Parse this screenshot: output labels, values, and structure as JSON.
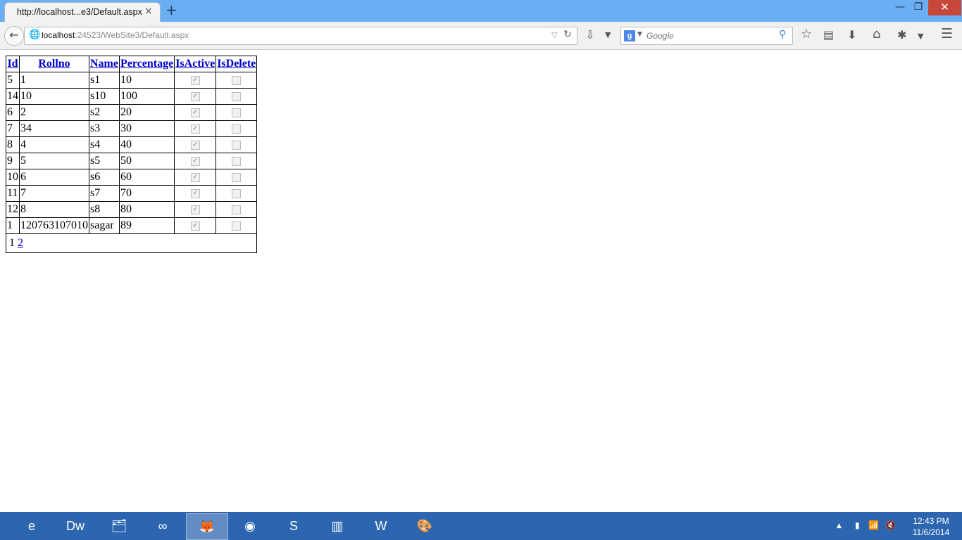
{
  "browser": {
    "tab_title": "http://localhost...e3/Default.aspx",
    "close_tab": "×",
    "new_tab": "+",
    "url_host": "localhost",
    "url_rest": ":24523/WebSite3/Default.aspx",
    "search_placeholder": "Google",
    "window_controls": {
      "minimize": "—",
      "maximize": "❐",
      "close": "✕"
    }
  },
  "grid": {
    "headers": [
      "Id",
      "Rollno",
      "Name",
      "Percentage",
      "IsActive",
      "IsDelete"
    ],
    "rows": [
      {
        "id": "5",
        "rollno": "1",
        "name": "s1",
        "percentage": "10",
        "isactive": true,
        "isdelete": false
      },
      {
        "id": "14",
        "rollno": "10",
        "name": "s10",
        "percentage": "100",
        "isactive": true,
        "isdelete": false
      },
      {
        "id": "6",
        "rollno": "2",
        "name": "s2",
        "percentage": "20",
        "isactive": true,
        "isdelete": false
      },
      {
        "id": "7",
        "rollno": "34",
        "name": "s3",
        "percentage": "30",
        "isactive": true,
        "isdelete": false
      },
      {
        "id": "8",
        "rollno": "4",
        "name": "s4",
        "percentage": "40",
        "isactive": true,
        "isdelete": false
      },
      {
        "id": "9",
        "rollno": "5",
        "name": "s5",
        "percentage": "50",
        "isactive": true,
        "isdelete": false
      },
      {
        "id": "10",
        "rollno": "6",
        "name": "s6",
        "percentage": "60",
        "isactive": true,
        "isdelete": false
      },
      {
        "id": "11",
        "rollno": "7",
        "name": "s7",
        "percentage": "70",
        "isactive": true,
        "isdelete": false
      },
      {
        "id": "12",
        "rollno": "8",
        "name": "s8",
        "percentage": "80",
        "isactive": true,
        "isdelete": false
      },
      {
        "id": "1",
        "rollno": "120763107010",
        "name": "sagar",
        "percentage": "89",
        "isactive": true,
        "isdelete": false
      }
    ],
    "pager": {
      "current": "1",
      "next": "2"
    }
  },
  "taskbar": {
    "apps": [
      {
        "icon": "internet-explorer-icon",
        "label": "e"
      },
      {
        "icon": "dreamweaver-icon",
        "label": "Dw"
      },
      {
        "icon": "file-explorer-icon",
        "label": "🗂"
      },
      {
        "icon": "visual-studio-icon",
        "label": "∞"
      },
      {
        "icon": "firefox-icon",
        "label": "🦊"
      },
      {
        "icon": "chrome-icon",
        "label": "◉"
      },
      {
        "icon": "skype-icon",
        "label": "S"
      },
      {
        "icon": "sql-tool-icon",
        "label": "▥"
      },
      {
        "icon": "word-icon",
        "label": "W"
      },
      {
        "icon": "paint-icon",
        "label": "🎨"
      }
    ],
    "time": "12:43 PM",
    "date": "11/6/2014"
  }
}
